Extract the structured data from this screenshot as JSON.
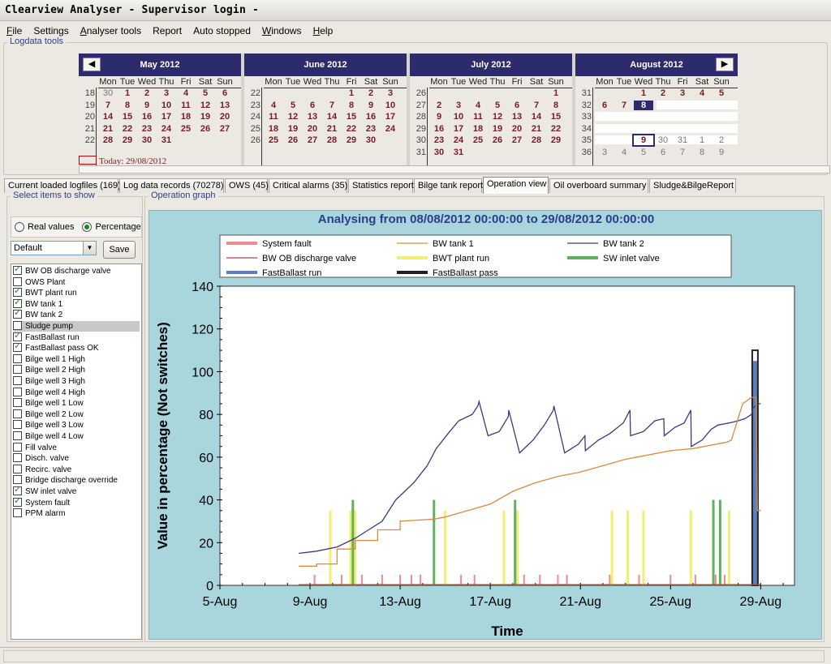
{
  "window": {
    "title": "Clearview Analyser - Supervisor login -"
  },
  "menu": [
    {
      "label": "File",
      "u": "F",
      "rest": "ile"
    },
    {
      "label": "Settings",
      "u": "",
      "rest": "Settings"
    },
    {
      "label": "Analyser tools",
      "u": "A",
      "rest": "nalyser tools"
    },
    {
      "label": "Report",
      "u": "",
      "rest": "Report"
    },
    {
      "label": "Auto stopped",
      "u": "",
      "rest": "Auto stopped"
    },
    {
      "label": "Windows",
      "u": "W",
      "rest": "indows"
    },
    {
      "label": "Help",
      "u": "H",
      "rest": "elp"
    }
  ],
  "logdata": {
    "group_label": "Logdata tools",
    "prev_icon": "chevron-left-icon",
    "next_icon": "chevron-right-icon",
    "today_label": "Today: 29/08/2012",
    "dow": [
      "Mon",
      "Tue",
      "Wed",
      "Thu",
      "Fri",
      "Sat",
      "Sun"
    ],
    "months": [
      {
        "name": "May 2012",
        "weeks": [
          "18",
          "19",
          "20",
          "21",
          "22"
        ],
        "rows": [
          [
            "30",
            "1",
            "2",
            "3",
            "4",
            "5",
            "6"
          ],
          [
            "7",
            "8",
            "9",
            "10",
            "11",
            "12",
            "13"
          ],
          [
            "14",
            "15",
            "16",
            "17",
            "18",
            "19",
            "20"
          ],
          [
            "21",
            "22",
            "23",
            "24",
            "25",
            "26",
            "27"
          ],
          [
            "28",
            "29",
            "30",
            "31",
            "",
            "",
            ""
          ]
        ],
        "other": [
          [
            0,
            0
          ]
        ]
      },
      {
        "name": "June 2012",
        "weeks": [
          "22",
          "23",
          "24",
          "25",
          "26"
        ],
        "rows": [
          [
            "",
            "",
            "",
            "",
            "1",
            "2",
            "3"
          ],
          [
            "4",
            "5",
            "6",
            "7",
            "8",
            "9",
            "10"
          ],
          [
            "11",
            "12",
            "13",
            "14",
            "15",
            "16",
            "17"
          ],
          [
            "18",
            "19",
            "20",
            "21",
            "22",
            "23",
            "24"
          ],
          [
            "25",
            "26",
            "27",
            "28",
            "29",
            "30",
            ""
          ]
        ],
        "other": []
      },
      {
        "name": "July 2012",
        "weeks": [
          "26",
          "27",
          "28",
          "29",
          "30",
          "31"
        ],
        "rows": [
          [
            "",
            "",
            "",
            "",
            "",
            "",
            "1"
          ],
          [
            "2",
            "3",
            "4",
            "5",
            "6",
            "7",
            "8"
          ],
          [
            "9",
            "10",
            "11",
            "12",
            "13",
            "14",
            "15"
          ],
          [
            "16",
            "17",
            "18",
            "19",
            "20",
            "21",
            "22"
          ],
          [
            "23",
            "24",
            "25",
            "26",
            "27",
            "28",
            "29"
          ],
          [
            "30",
            "31",
            "",
            "",
            "",
            "",
            ""
          ]
        ],
        "other": []
      },
      {
        "name": "August 2012",
        "weeks": [
          "31",
          "32",
          "33",
          "34",
          "35",
          "36"
        ],
        "rows": [
          [
            "",
            "",
            "1",
            "2",
            "3",
            "4",
            "5"
          ],
          [
            "6",
            "7",
            "8",
            "",
            "",
            "",
            ""
          ],
          [
            "",
            "",
            "",
            "",
            "",
            "",
            ""
          ],
          [
            "",
            "",
            "",
            "",
            "",
            "",
            ""
          ],
          [
            "",
            "",
            "",
            "",
            "",
            "",
            ""
          ],
          [
            "3",
            "4",
            "5",
            "6",
            "7",
            "8",
            "9"
          ]
        ],
        "extra": {
          "row4": [
            "",
            "",
            "9",
            "30",
            "31",
            "1",
            "2"
          ]
        },
        "other": []
      }
    ]
  },
  "tabs": [
    {
      "label": "Current loaded logfiles (169)"
    },
    {
      "label": "Log data records (70278)"
    },
    {
      "label": "OWS (45)"
    },
    {
      "label": "Critical alarms (35)"
    },
    {
      "label": "Statistics report"
    },
    {
      "label": "Bilge tank report"
    },
    {
      "label": "Operation view",
      "active": true
    },
    {
      "label": "Oil overboard summary"
    },
    {
      "label": "Sludge&BilgeReport"
    }
  ],
  "left_panel": {
    "group_label": "Select items to show",
    "radio_real": "Real values",
    "radio_percentage": "Percentage",
    "selected_preset": "Default",
    "save_label": "Save",
    "items": [
      {
        "label": "BW OB discharge valve",
        "checked": true
      },
      {
        "label": "OWS Plant",
        "checked": false
      },
      {
        "label": "BWT plant run",
        "checked": true
      },
      {
        "label": "BW tank 1",
        "checked": true
      },
      {
        "label": "BW tank 2",
        "checked": true
      },
      {
        "label": "Sludge pump",
        "checked": false,
        "highlight": true
      },
      {
        "label": "FastBallast run",
        "checked": true
      },
      {
        "label": "FastBallast pass OK",
        "checked": true
      },
      {
        "label": "Bilge well 1 High",
        "checked": false
      },
      {
        "label": "Bilge well 2 High",
        "checked": false
      },
      {
        "label": "Bilge well 3 High",
        "checked": false
      },
      {
        "label": "Bilge well 4 High",
        "checked": false
      },
      {
        "label": "Bilge well 1 Low",
        "checked": false
      },
      {
        "label": "Bilge well 2 Low",
        "checked": false
      },
      {
        "label": "Bilge well 3 Low",
        "checked": false
      },
      {
        "label": "Bilge well 4 Low",
        "checked": false
      },
      {
        "label": "Fill valve",
        "checked": false
      },
      {
        "label": "Disch. valve",
        "checked": false
      },
      {
        "label": "Recirc. valve",
        "checked": false
      },
      {
        "label": "Bridge discharge override",
        "checked": false
      },
      {
        "label": "SW inlet valve",
        "checked": true
      },
      {
        "label": "System fault",
        "checked": true
      },
      {
        "label": "PPM alarm",
        "checked": false
      }
    ]
  },
  "graph": {
    "group_label": "Operation graph",
    "colors": {
      "bg": "#a9d5dd",
      "title": "#2d3d8e"
    },
    "chart_data": {
      "type": "line",
      "title": "Analysing from 08/08/2012 00:00:00 to 29/08/2012 00:00:00",
      "xlabel": "Time",
      "ylabel": "Value in percentage (Not switches)",
      "xlim": [
        5,
        30.5
      ],
      "ylim": [
        0,
        140
      ],
      "xticks": [
        5,
        9,
        13,
        17,
        21,
        25,
        29
      ],
      "xtick_labels": [
        "5-Aug",
        "9-Aug",
        "13-Aug",
        "17-Aug",
        "21-Aug",
        "25-Aug",
        "29-Aug"
      ],
      "yticks": [
        0,
        20,
        40,
        60,
        80,
        100,
        120,
        140
      ],
      "legend": [
        {
          "name": "System fault",
          "color": "#f08a92",
          "width": 3
        },
        {
          "name": "BW tank 1",
          "color": "#d98a40",
          "width": 1
        },
        {
          "name": "BW tank 2",
          "color": "#3a3a7c",
          "width": 1
        },
        {
          "name": "BW OB discharge valve",
          "color": "#b34040",
          "width": 1
        },
        {
          "name": "BWT plant run",
          "color": "#f2ee70",
          "width": 3
        },
        {
          "name": "SW inlet valve",
          "color": "#5fb05f",
          "width": 3
        },
        {
          "name": "FastBallast run",
          "color": "#5a7ec0",
          "width": 3
        },
        {
          "name": "FastBallast pass",
          "color": "#222222",
          "width": 3
        }
      ],
      "series": [
        {
          "name": "BW tank 2",
          "color": "#3a3a7c",
          "x": [
            8.5,
            9.3,
            10.2,
            11.0,
            11.6,
            12.2,
            12.8,
            13.6,
            14.2,
            14.6,
            15.2,
            15.6,
            16.2,
            16.45,
            16.5,
            16.9,
            17.4,
            17.8,
            17.82,
            18.3,
            18.9,
            19.4,
            19.8,
            19.82,
            20.3,
            20.9,
            21.2,
            21.22,
            21.8,
            22.3,
            22.9,
            23.2,
            23.22,
            23.8,
            24.3,
            24.7,
            24.72,
            25.2,
            25.6,
            25.9,
            25.92,
            26.4,
            26.8,
            27.1,
            27.6,
            28.0,
            28.3,
            28.6,
            28.65,
            28.9,
            29.0
          ],
          "y": [
            15,
            16,
            18,
            22,
            26,
            30,
            40,
            48,
            56,
            64,
            72,
            77,
            80,
            84,
            86,
            70,
            72,
            79,
            82,
            62,
            68,
            75,
            82,
            84,
            62,
            66,
            70,
            63,
            68,
            71,
            76,
            82,
            70,
            72,
            77,
            78,
            70,
            74,
            76,
            82,
            65,
            68,
            73,
            75,
            76,
            77,
            78,
            80,
            83,
            85,
            85
          ]
        },
        {
          "name": "BW tank 1",
          "color": "#d98a40",
          "x": [
            8.5,
            9.3,
            9.3,
            10.2,
            10.2,
            11.0,
            11.0,
            12.0,
            12.0,
            13.0,
            13.0,
            14.5,
            15.0,
            16.0,
            17.0,
            18.0,
            19.0,
            20.0,
            21.0,
            22.0,
            23.0,
            24.0,
            25.0,
            26.0,
            26.5,
            27.0,
            27.5,
            27.7,
            28.2,
            28.6,
            28.8,
            28.85,
            29.0
          ],
          "y": [
            9,
            9,
            10,
            10,
            17,
            17,
            21,
            21,
            26,
            26,
            30,
            31,
            32,
            35,
            38,
            44,
            48,
            51,
            53,
            56,
            59,
            61,
            63,
            64,
            65,
            66,
            67,
            68,
            85,
            88,
            88,
            35,
            35
          ]
        },
        {
          "name": "BW OB discharge valve",
          "color": "#b34040",
          "x": [
            8.5,
            29.0
          ],
          "y": [
            0.3,
            0.3
          ]
        }
      ],
      "bars": [
        {
          "name": "System fault",
          "color": "#f08a92",
          "x": [
            9.2,
            10.4,
            11.3,
            12.2,
            13.0,
            13.5,
            13.9,
            15.7,
            16.3,
            18.5,
            19.2,
            20.0,
            20.4,
            22.3,
            23.6,
            25.0,
            26.1,
            27.0,
            27.4
          ],
          "height": 5
        },
        {
          "name": "BWT plant run",
          "color": "#f2ee70",
          "x": [
            9.9,
            10.8,
            11.0,
            15.0,
            17.6,
            18.2,
            22.4,
            23.1,
            23.8,
            25.9,
            27.6
          ],
          "height": 35
        },
        {
          "name": "SW inlet valve",
          "color": "#5fb05f",
          "x": [
            10.9,
            14.5,
            18.1,
            26.9,
            27.2
          ],
          "height": 40
        },
        {
          "name": "FastBallast run",
          "color": "#5a7ec0",
          "x": [
            28.75
          ],
          "height": 105
        },
        {
          "name": "FastBallast pass",
          "color": "#222222",
          "x": [
            28.75
          ],
          "height": 110
        }
      ]
    }
  }
}
